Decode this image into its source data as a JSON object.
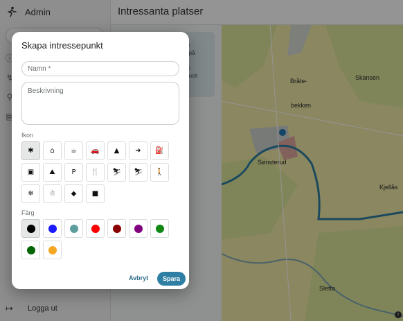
{
  "app": {
    "brand_name": "Admin"
  },
  "sidebar": {
    "nav_icons": [
      "info-icon",
      "route-icon",
      "pin-icon",
      "chat-icon"
    ],
    "logout_label": "Logga ut"
  },
  "page": {
    "title": "Intressanta platser"
  },
  "info_panel": {
    "text": "ny\na på\nn\nen\na och"
  },
  "map": {
    "labels": [
      "Bråte-",
      "bekken",
      "Skansen",
      "Sønsterud",
      "Kjellås",
      "Sletta"
    ],
    "colors": {
      "land": "#efe9a6",
      "forest": "#dbe59a",
      "river": "#2d7fa3",
      "marker": "#1f78b4"
    }
  },
  "dialog": {
    "title": "Skapa intressepunkt",
    "name_placeholder": "Namn *",
    "description_placeholder": "Beskrivning",
    "icon_section_label": "Ikon",
    "color_section_label": "Färg",
    "icons": [
      {
        "name": "asterisk-icon",
        "glyph": "✱",
        "selected": true
      },
      {
        "name": "house-icon",
        "glyph": "⌂"
      },
      {
        "name": "coffee-icon",
        "glyph": "☕"
      },
      {
        "name": "car-icon",
        "glyph": "🚗"
      },
      {
        "name": "warning-icon",
        "glyph": "▲"
      },
      {
        "name": "arrow-right-icon",
        "glyph": "➜"
      },
      {
        "name": "fuel-icon",
        "glyph": "⛽"
      },
      {
        "name": "image-icon",
        "glyph": "▣"
      },
      {
        "name": "mountain-icon",
        "glyph": "⛰"
      },
      {
        "name": "parking-icon",
        "glyph": "P"
      },
      {
        "name": "restaurant-icon",
        "glyph": "🍴"
      },
      {
        "name": "lift-icon",
        "glyph": "⛷"
      },
      {
        "name": "skier-icon",
        "glyph": "⛷"
      },
      {
        "name": "hiker-icon",
        "glyph": "🚶"
      },
      {
        "name": "snowflake-icon",
        "glyph": "❄"
      },
      {
        "name": "snowman-icon",
        "glyph": "☃"
      },
      {
        "name": "diamond-icon",
        "glyph": "◆"
      },
      {
        "name": "video-icon",
        "glyph": "■"
      }
    ],
    "colors": [
      {
        "name": "black",
        "hex": "#000000",
        "selected": true
      },
      {
        "name": "blue",
        "hex": "#1a1aff"
      },
      {
        "name": "teal",
        "hex": "#5f9ea0"
      },
      {
        "name": "red",
        "hex": "#ff0000"
      },
      {
        "name": "darkred",
        "hex": "#8b0000"
      },
      {
        "name": "purple",
        "hex": "#800080"
      },
      {
        "name": "green",
        "hex": "#118811"
      },
      {
        "name": "darkgreen",
        "hex": "#006400"
      },
      {
        "name": "orange",
        "hex": "#f5a623"
      }
    ],
    "cancel_label": "Avbryt",
    "save_label": "Spara"
  }
}
